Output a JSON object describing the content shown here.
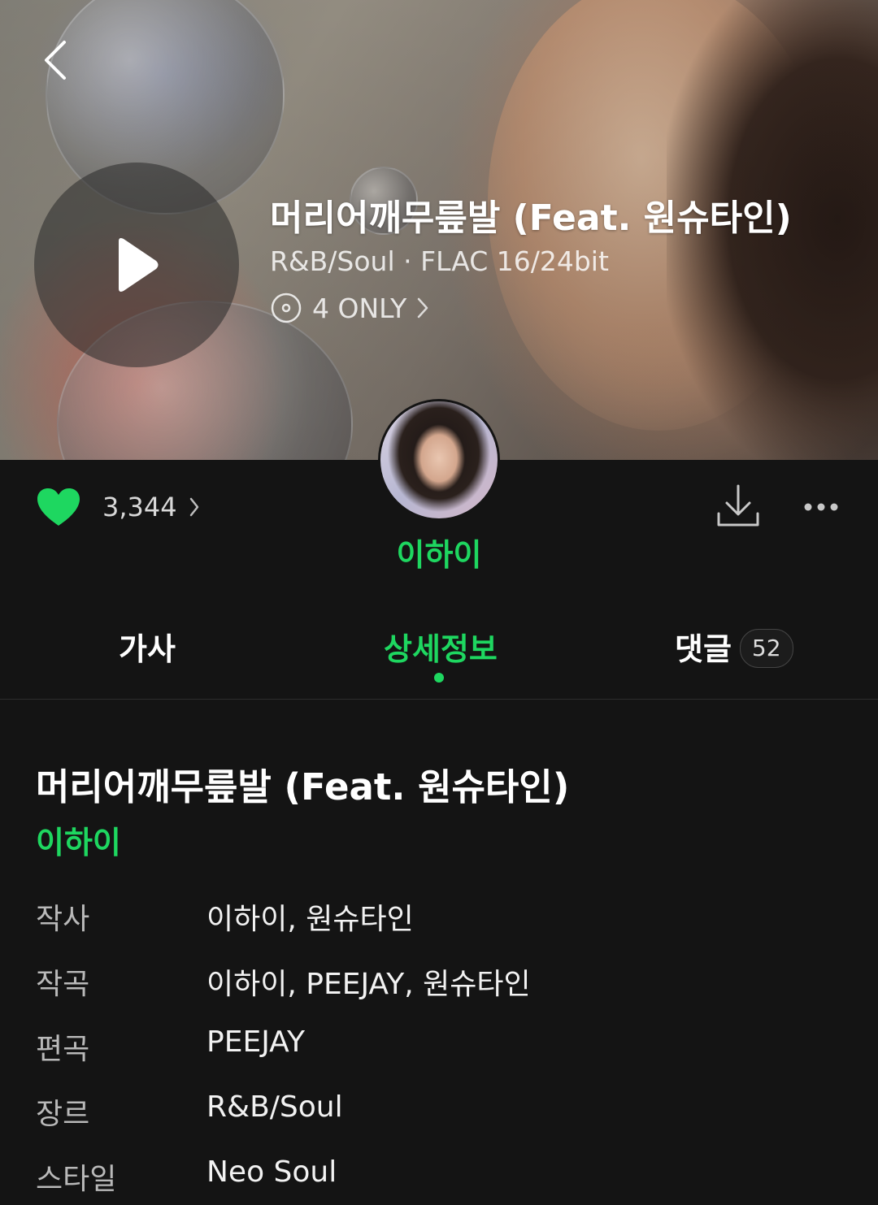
{
  "song": {
    "title": "머리어깨무릎발 (Feat. 원슈타인)",
    "meta": "R&B/Soul · FLAC 16/24bit",
    "only_label": "4 ONLY"
  },
  "actions": {
    "like_count": "3,344"
  },
  "artist": {
    "name": "이하이"
  },
  "tabs": [
    {
      "label": "가사"
    },
    {
      "label": "상세정보"
    },
    {
      "label": "댓글",
      "badge": "52"
    }
  ],
  "detail": {
    "title": "머리어깨무릎발 (Feat. 원슈타인)",
    "artist": "이하이",
    "rows": [
      {
        "label": "작사",
        "value": "이하이, 원슈타인"
      },
      {
        "label": "작곡",
        "value": "이하이, PEEJAY, 원슈타인"
      },
      {
        "label": "편곡",
        "value": "PEEJAY"
      },
      {
        "label": "장르",
        "value": "R&B/Soul"
      },
      {
        "label": "스타일",
        "value": "Neo Soul"
      }
    ]
  },
  "colors": {
    "accent": "#1ed760",
    "background": "#141414"
  }
}
